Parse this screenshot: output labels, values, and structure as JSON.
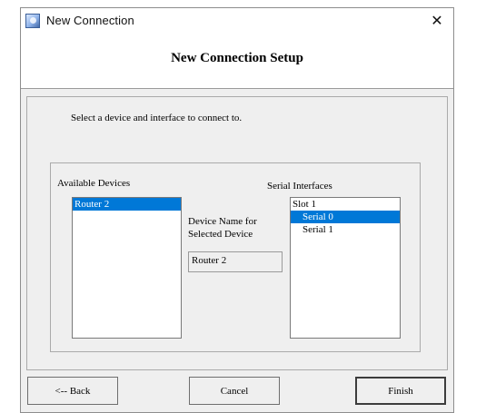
{
  "window": {
    "title": "New Connection",
    "icon": "app-icon"
  },
  "header": {
    "title": "New Connection Setup"
  },
  "instruction": "Select a device and interface to connect to.",
  "devices": {
    "label": "Available Devices",
    "items": [
      "Router 2"
    ],
    "selected": "Router 2"
  },
  "device_name": {
    "label_line1": "Device Name for",
    "label_line2": "Selected Device",
    "value": "Router 2"
  },
  "interfaces": {
    "label": "Serial Interfaces",
    "items": [
      {
        "label": "Slot 1",
        "selected": false
      },
      {
        "label": "Serial 0",
        "selected": true
      },
      {
        "label": "Serial 1",
        "selected": false
      }
    ]
  },
  "buttons": {
    "back": "<-- Back",
    "cancel": "Cancel",
    "finish": "Finish"
  },
  "colors": {
    "selection": "#0078d7",
    "dialog_bg": "#efefef"
  }
}
